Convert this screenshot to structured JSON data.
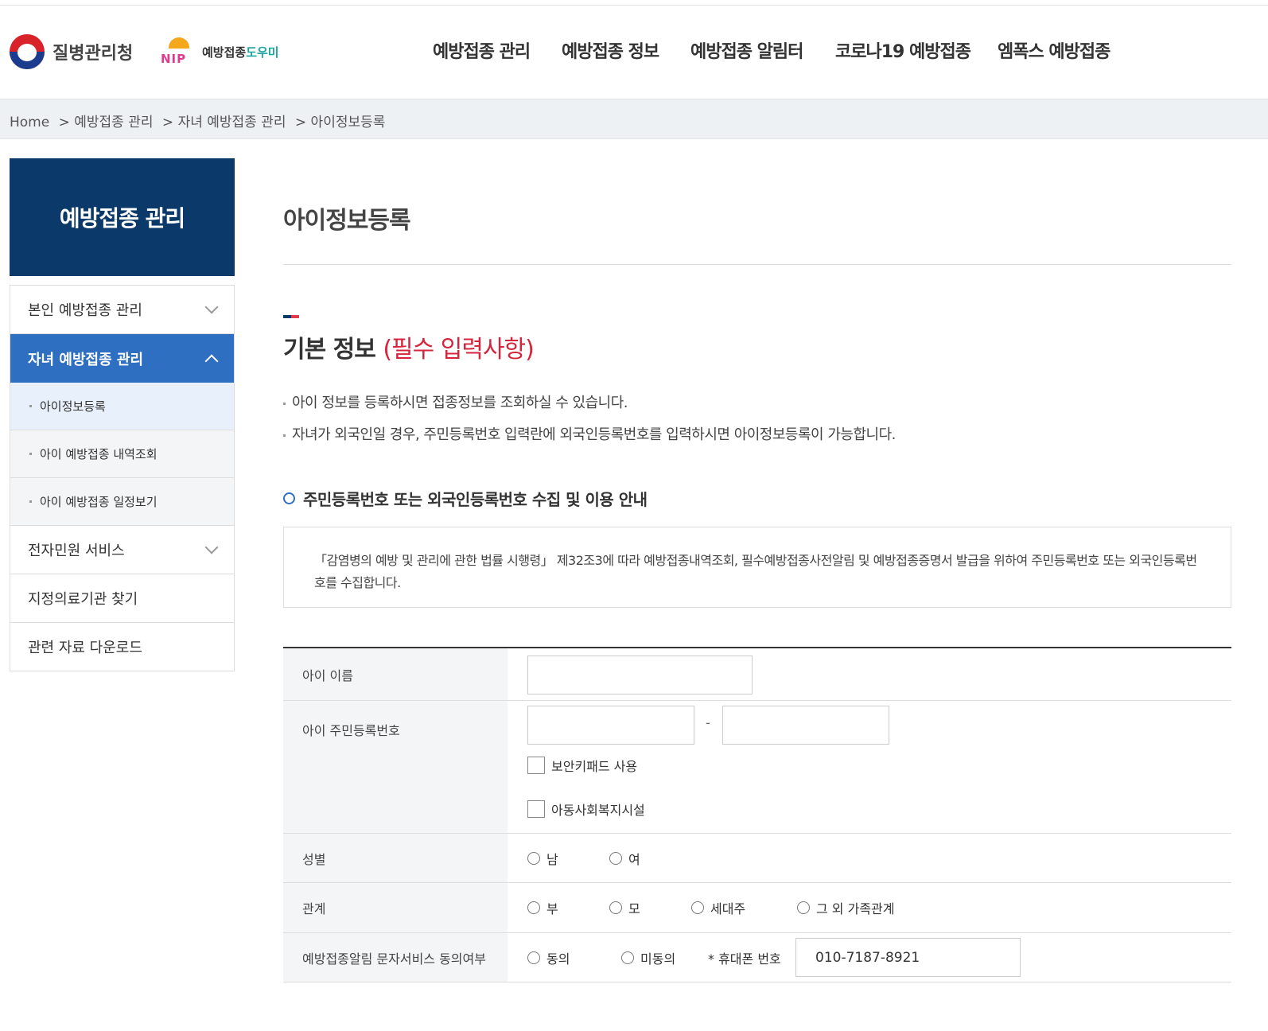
{
  "header": {
    "org_name": "질병관리청",
    "nip_text": "NIP",
    "helper_name_a": "예방접종",
    "helper_name_b": "도우미",
    "nav": [
      "예방접종 관리",
      "예방접종 정보",
      "예방접종 알림터",
      "코로나19 예방접종",
      "엠폭스 예방접종"
    ]
  },
  "breadcrumb": [
    "Home",
    "> 예방접종 관리",
    "> 자녀 예방접종 관리",
    "> 아이정보등록"
  ],
  "sidebar": {
    "title": "예방접종 관리",
    "items": [
      {
        "label": "본인 예방접종 관리"
      },
      {
        "label": "자녀 예방접종 관리"
      },
      {
        "label": "아이정보등록"
      },
      {
        "label": "아이 예방접종 내역조회"
      },
      {
        "label": "아이 예방접종 일정보기"
      },
      {
        "label": "전자민원 서비스"
      },
      {
        "label": "지정의료기관 찾기"
      },
      {
        "label": "관련 자료 다운로드"
      }
    ]
  },
  "main": {
    "page_title": "아이정보등록",
    "section_title": "기본 정보",
    "section_required": "(필수 입력사항)",
    "notes": [
      "아이 정보를 등록하시면 접종정보를 조회하실 수 있습니다.",
      "자녀가 외국인일 경우, 주민등록번호 입력란에 외국인등록번호를 입력하시면 아이정보등록이 가능합니다."
    ],
    "sub_heading": "주민등록번호 또는 외국인등록번호 수집 및 이용 안내",
    "info_text": "「감염병의 예방 및 관리에 관한 법률 시행령」 제32조3에 따라 예방접종내역조회, 필수예방접종사전알림 및 예방접종증명서 발급을 위하여 주민등록번호 또는 외국인등록번호를 수집합니다."
  },
  "form": {
    "name_label": "아이 이름",
    "name_value": "",
    "rrn_label": "아이 주민등록번호",
    "rrn_front": "",
    "rrn_dash": "-",
    "rrn_back": "",
    "secure_keypad": "보안키패드 사용",
    "welfare_facility": "아동사회복지시설",
    "gender_label": "성별",
    "gender_options": [
      "남",
      "여"
    ],
    "relation_label": "관계",
    "relation_options": [
      "부",
      "모",
      "세대주",
      "그 외 가족관계"
    ],
    "sms_label": "예방접종알림 문자서비스 동의여부",
    "sms_options": [
      "동의",
      "미동의"
    ],
    "phone_label": "* 휴대폰 번호",
    "phone_value": "010-7187-8921"
  }
}
